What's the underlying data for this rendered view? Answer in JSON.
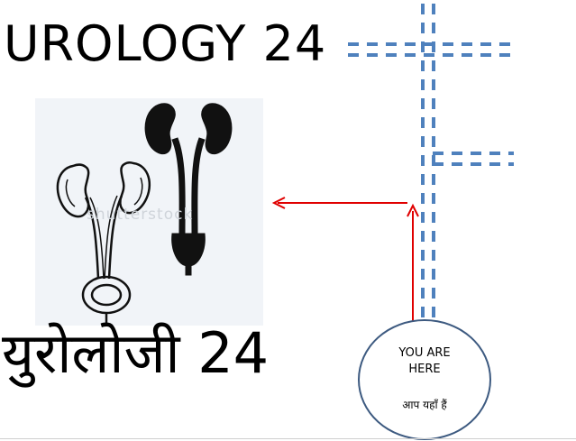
{
  "title_en": "UROLOGY  24",
  "title_hi": "युरोलोजी 24",
  "watermark": "shutterstock",
  "you_are_here": {
    "line1": "YOU ARE",
    "line2": "HERE",
    "hindi": "आप यहाँ हैं"
  },
  "colors": {
    "dash": "#4f81bd",
    "arrow": "#e00000",
    "circle_border": "#3d5a80"
  },
  "icons": [
    "kidney-outline-icon",
    "kidney-silhouette-icon"
  ]
}
